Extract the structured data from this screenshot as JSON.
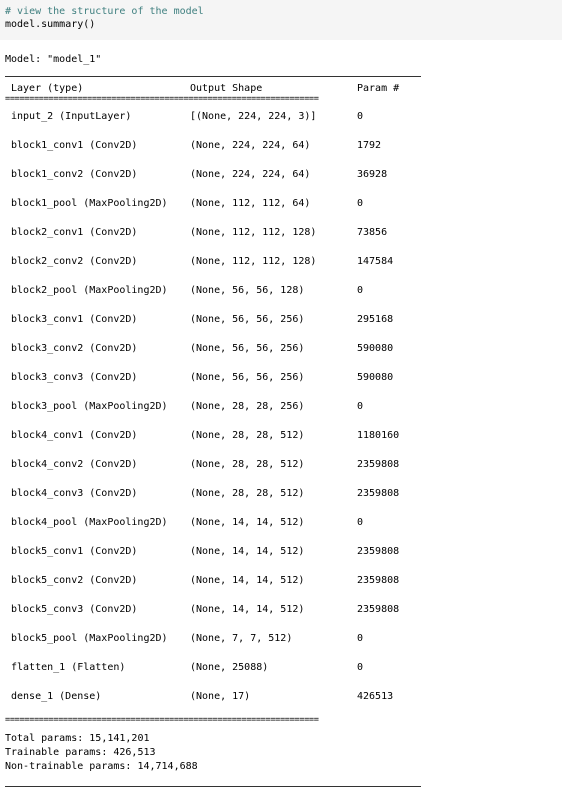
{
  "code_cell": {
    "comment": "# view the structure of the model",
    "code": "model.summary()"
  },
  "output": {
    "model_line": "Model: \"model_1\"",
    "headers": {
      "layer": "Layer (type)",
      "shape": "Output Shape",
      "param": "Param #"
    },
    "double_rule_text": "=================================================================",
    "rows": [
      {
        "layer": "input_2 (InputLayer)",
        "shape": "[(None, 224, 224, 3)]",
        "param": "0"
      },
      {
        "layer": "block1_conv1 (Conv2D)",
        "shape": "(None, 224, 224, 64)",
        "param": "1792"
      },
      {
        "layer": "block1_conv2 (Conv2D)",
        "shape": "(None, 224, 224, 64)",
        "param": "36928"
      },
      {
        "layer": "block1_pool (MaxPooling2D)",
        "shape": "(None, 112, 112, 64)",
        "param": "0"
      },
      {
        "layer": "block2_conv1 (Conv2D)",
        "shape": "(None, 112, 112, 128)",
        "param": "73856"
      },
      {
        "layer": "block2_conv2 (Conv2D)",
        "shape": "(None, 112, 112, 128)",
        "param": "147584"
      },
      {
        "layer": "block2_pool (MaxPooling2D)",
        "shape": "(None, 56, 56, 128)",
        "param": "0"
      },
      {
        "layer": "block3_conv1 (Conv2D)",
        "shape": "(None, 56, 56, 256)",
        "param": "295168"
      },
      {
        "layer": "block3_conv2 (Conv2D)",
        "shape": "(None, 56, 56, 256)",
        "param": "590080"
      },
      {
        "layer": "block3_conv3 (Conv2D)",
        "shape": "(None, 56, 56, 256)",
        "param": "590080"
      },
      {
        "layer": "block3_pool (MaxPooling2D)",
        "shape": "(None, 28, 28, 256)",
        "param": "0"
      },
      {
        "layer": "block4_conv1 (Conv2D)",
        "shape": "(None, 28, 28, 512)",
        "param": "1180160"
      },
      {
        "layer": "block4_conv2 (Conv2D)",
        "shape": "(None, 28, 28, 512)",
        "param": "2359808"
      },
      {
        "layer": "block4_conv3 (Conv2D)",
        "shape": "(None, 28, 28, 512)",
        "param": "2359808"
      },
      {
        "layer": "block4_pool (MaxPooling2D)",
        "shape": "(None, 14, 14, 512)",
        "param": "0"
      },
      {
        "layer": "block5_conv1 (Conv2D)",
        "shape": "(None, 14, 14, 512)",
        "param": "2359808"
      },
      {
        "layer": "block5_conv2 (Conv2D)",
        "shape": "(None, 14, 14, 512)",
        "param": "2359808"
      },
      {
        "layer": "block5_conv3 (Conv2D)",
        "shape": "(None, 14, 14, 512)",
        "param": "2359808"
      },
      {
        "layer": "block5_pool (MaxPooling2D)",
        "shape": "(None, 7, 7, 512)",
        "param": "0"
      },
      {
        "layer": "flatten_1 (Flatten)",
        "shape": "(None, 25088)",
        "param": "0"
      },
      {
        "layer": "dense_1 (Dense)",
        "shape": "(None, 17)",
        "param": "426513"
      }
    ],
    "total_params": "Total params: 15,141,201",
    "trainable_params": "Trainable params: 426,513",
    "non_trainable_params": "Non-trainable params: 14,714,688"
  }
}
